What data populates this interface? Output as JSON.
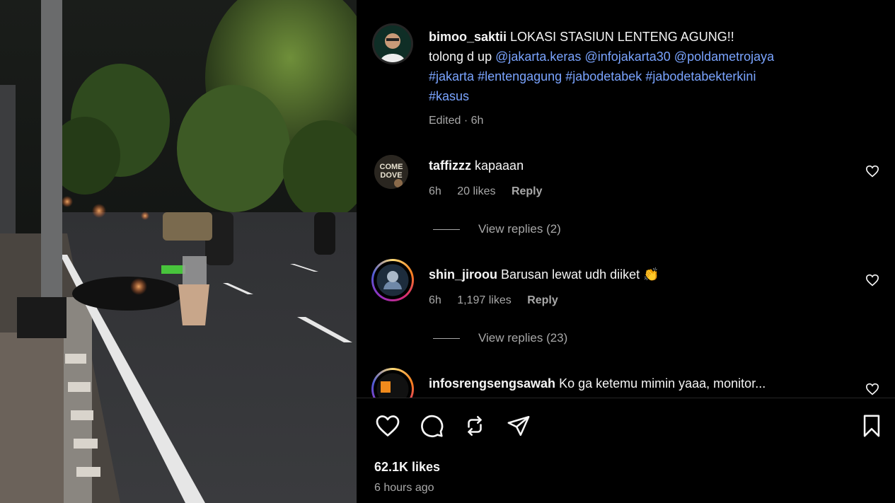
{
  "post": {
    "username": "bimoo_saktii",
    "caption_text": "LOKASI STASIUN LENTENG AGUNG!!",
    "caption_line2": "tolong d up",
    "mentions": [
      "@jakarta.keras",
      "@infojakarta30",
      "@poldametrojaya"
    ],
    "hashtags": [
      "#jakarta",
      "#lentengagung",
      "#jabodetabek",
      "#jabodetabekterkini",
      "#kasus"
    ],
    "edited": "Edited · 6h"
  },
  "comments": [
    {
      "username": "taffizzz",
      "text": "kapaaan",
      "time": "6h",
      "likes": "20 likes",
      "reply": "Reply",
      "view_replies": "View replies (2)"
    },
    {
      "username": "shin_jiroou",
      "text": "Barusan lewat udh diiket",
      "emoji": "👏",
      "time": "6h",
      "likes": "1,197 likes",
      "reply": "Reply",
      "view_replies": "View replies (23)"
    },
    {
      "username": "infosrengsengsawah",
      "text": "Ko ga ketemu mimin yaaa, monitor..."
    }
  ],
  "footer": {
    "likes": "62.1K likes",
    "time_ago": "6 hours ago"
  },
  "icons": {
    "like": "heart-icon",
    "comment": "comment-icon",
    "repost": "repost-icon",
    "share": "send-icon",
    "save": "bookmark-icon"
  },
  "colors": {
    "background": "#000000",
    "link": "#7aa4ff",
    "secondary_text": "#a8a8a8",
    "primary_text": "#f5f5f5"
  }
}
